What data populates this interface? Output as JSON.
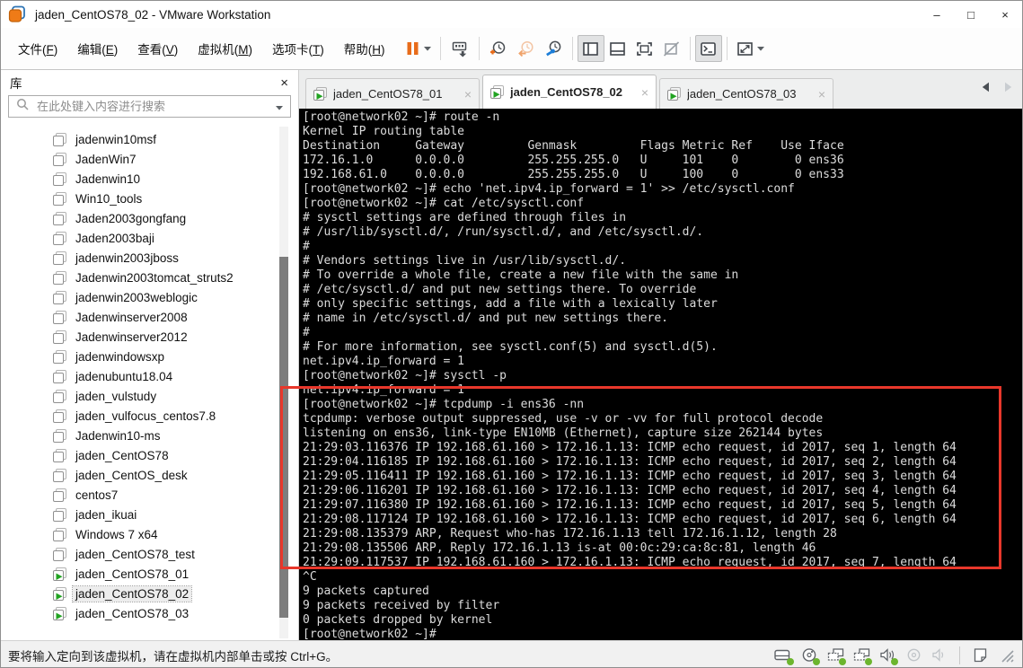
{
  "window": {
    "title": "jaden_CentOS78_02 - VMware Workstation",
    "controls": {
      "minimize": "–",
      "maximize": "□",
      "close": "×"
    }
  },
  "menubar": {
    "items": [
      "文件(F)",
      "编辑(E)",
      "查看(V)",
      "虚拟机(M)",
      "选项卡(T)",
      "帮助(H)"
    ]
  },
  "toolbar": {
    "groups": [
      [
        {
          "name": "suspend-button",
          "icon": "pause-icon",
          "dropdown": true
        }
      ],
      [
        {
          "name": "send-ctrl-alt-del-button",
          "icon": "send-cad-icon"
        }
      ],
      [
        {
          "name": "take-snapshot-button",
          "icon": "snapshot-take-icon"
        },
        {
          "name": "revert-snapshot-button",
          "icon": "snapshot-revert-icon",
          "disabled": true
        },
        {
          "name": "manage-snapshots-button",
          "icon": "snapshot-manage-icon"
        }
      ],
      [
        {
          "name": "show-library-button",
          "icon": "library-panel-icon",
          "active": true
        },
        {
          "name": "show-thumbnail-bar-button",
          "icon": "thumbnail-bar-icon"
        },
        {
          "name": "enter-fullscreen-button",
          "icon": "fullscreen-icon"
        },
        {
          "name": "unity-mode-button",
          "icon": "unity-icon",
          "disabled": true
        }
      ],
      [
        {
          "name": "console-view-button",
          "icon": "console-view-icon",
          "active": true
        }
      ],
      [
        {
          "name": "fit-guest-button",
          "icon": "fit-guest-icon",
          "dropdown": true
        }
      ]
    ]
  },
  "sidebar": {
    "title": "库",
    "close_glyph": "×",
    "search_placeholder": "在此处键入内容进行搜索",
    "items": [
      {
        "label": "jadenwin10msf",
        "state": "off"
      },
      {
        "label": "JadenWin7",
        "state": "off"
      },
      {
        "label": "Jadenwin10",
        "state": "off"
      },
      {
        "label": "Win10_tools",
        "state": "off"
      },
      {
        "label": "Jaden2003gongfang",
        "state": "off"
      },
      {
        "label": "Jaden2003baji",
        "state": "off"
      },
      {
        "label": "jadenwin2003jboss",
        "state": "off"
      },
      {
        "label": "Jadenwin2003tomcat_struts2",
        "state": "off"
      },
      {
        "label": "jadenwin2003weblogic",
        "state": "off"
      },
      {
        "label": "Jadenwinserver2008",
        "state": "off"
      },
      {
        "label": "Jadenwinserver2012",
        "state": "off"
      },
      {
        "label": "jadenwindowsxp",
        "state": "off"
      },
      {
        "label": "jadenubuntu18.04",
        "state": "off"
      },
      {
        "label": "jaden_vulstudy",
        "state": "off"
      },
      {
        "label": "jaden_vulfocus_centos7.8",
        "state": "off"
      },
      {
        "label": "Jadenwin10-ms",
        "state": "off"
      },
      {
        "label": "jaden_CentOS78",
        "state": "off"
      },
      {
        "label": "jaden_CentOS_desk",
        "state": "off"
      },
      {
        "label": "centos7",
        "state": "off"
      },
      {
        "label": "jaden_ikuai",
        "state": "off"
      },
      {
        "label": "Windows 7 x64",
        "state": "off"
      },
      {
        "label": "jaden_CentOS78_test",
        "state": "off"
      },
      {
        "label": "jaden_CentOS78_01",
        "state": "running"
      },
      {
        "label": "jaden_CentOS78_02",
        "state": "running",
        "selected": true
      },
      {
        "label": "jaden_CentOS78_03",
        "state": "running"
      }
    ]
  },
  "tabs": {
    "close_glyph": "×",
    "items": [
      {
        "label": "jaden_CentOS78_01",
        "active": false
      },
      {
        "label": "jaden_CentOS78_02",
        "active": true
      },
      {
        "label": "jaden_CentOS78_03",
        "active": false
      }
    ]
  },
  "terminal": {
    "background": "#000000",
    "foreground": "#dcdcdc",
    "lines": [
      "[root@network02 ~]# route -n",
      "Kernel IP routing table",
      "Destination     Gateway         Genmask         Flags Metric Ref    Use Iface",
      "172.16.1.0      0.0.0.0         255.255.255.0   U     101    0        0 ens36",
      "192.168.61.0    0.0.0.0         255.255.255.0   U     100    0        0 ens33",
      "[root@network02 ~]# echo 'net.ipv4.ip_forward = 1' >> /etc/sysctl.conf",
      "[root@network02 ~]# cat /etc/sysctl.conf",
      "# sysctl settings are defined through files in",
      "# /usr/lib/sysctl.d/, /run/sysctl.d/, and /etc/sysctl.d/.",
      "#",
      "# Vendors settings live in /usr/lib/sysctl.d/.",
      "# To override a whole file, create a new file with the same in",
      "# /etc/sysctl.d/ and put new settings there. To override",
      "# only specific settings, add a file with a lexically later",
      "# name in /etc/sysctl.d/ and put new settings there.",
      "#",
      "# For more information, see sysctl.conf(5) and sysctl.d(5).",
      "net.ipv4.ip_forward = 1",
      "[root@network02 ~]# sysctl -p",
      "net.ipv4.ip_forward = 1",
      "[root@network02 ~]# tcpdump -i ens36 -nn",
      "tcpdump: verbose output suppressed, use -v or -vv for full protocol decode",
      "listening on ens36, link-type EN10MB (Ethernet), capture size 262144 bytes",
      "21:29:03.116376 IP 192.168.61.160 > 172.16.1.13: ICMP echo request, id 2017, seq 1, length 64",
      "21:29:04.116185 IP 192.168.61.160 > 172.16.1.13: ICMP echo request, id 2017, seq 2, length 64",
      "21:29:05.116411 IP 192.168.61.160 > 172.16.1.13: ICMP echo request, id 2017, seq 3, length 64",
      "21:29:06.116201 IP 192.168.61.160 > 172.16.1.13: ICMP echo request, id 2017, seq 4, length 64",
      "21:29:07.116380 IP 192.168.61.160 > 172.16.1.13: ICMP echo request, id 2017, seq 5, length 64",
      "21:29:08.117124 IP 192.168.61.160 > 172.16.1.13: ICMP echo request, id 2017, seq 6, length 64",
      "21:29:08.135379 ARP, Request who-has 172.16.1.13 tell 172.16.1.12, length 28",
      "21:29:08.135506 ARP, Reply 172.16.1.13 is-at 00:0c:29:ca:8c:81, length 46",
      "21:29:09.117537 IP 192.168.61.160 > 172.16.1.13: ICMP echo request, id 2017, seq 7, length 64",
      "^C",
      "9 packets captured",
      "9 packets received by filter",
      "0 packets dropped by kernel",
      "[root@network02 ~]# "
    ]
  },
  "annotation": {
    "type": "highlight-box",
    "color": "#e8372b"
  },
  "statusbar": {
    "message": "要将输入定向到该虚拟机，请在虚拟机内部单击或按 Ctrl+G。",
    "icons": [
      {
        "name": "hard-disk-icon",
        "icon": "hard-disk-icon",
        "connected": true
      },
      {
        "name": "cd-drive-icon",
        "icon": "cd-drive-icon",
        "connected": true
      },
      {
        "name": "network-adapter-icon",
        "icon": "network-adapter-icon",
        "connected": true
      },
      {
        "name": "network-adapter-2-icon",
        "icon": "network-adapter-icon",
        "connected": true
      },
      {
        "name": "sound-device-icon",
        "icon": "sound-device-icon",
        "connected": true
      },
      {
        "name": "cd-idle-icon",
        "icon": "cd-idle-icon"
      },
      {
        "name": "speaker-icon",
        "icon": "speaker-idle-icon"
      },
      {
        "name": "divider"
      },
      {
        "name": "message-log-icon",
        "icon": "message-log-icon"
      },
      {
        "name": "resize-grip-icon",
        "icon": "resize-grip-icon"
      }
    ]
  },
  "colors": {
    "accent_orange": "#e86c1a",
    "running_green": "#21a321",
    "device_green": "#6cb52e",
    "annotation_red": "#e8372b",
    "terminal_bg": "#000000"
  }
}
